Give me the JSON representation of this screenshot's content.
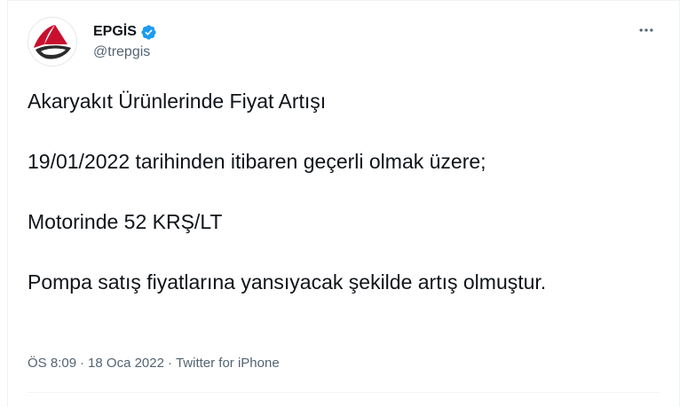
{
  "account": {
    "display_name": "EPGİS",
    "handle": "@trepgis",
    "verified_icon": "verified-badge-icon",
    "avatar_icon": "epgis-logo-icon"
  },
  "more_icon": "more-horizontal-icon",
  "tweet": {
    "lines": [
      "Akaryakıt Ürünlerinde Fiyat Artışı",
      "19/01/2022 tarihinden itibaren geçerli olmak üzere;",
      "Motorinde 52 KRŞ/LT",
      "Pompa satış fiyatlarına yansıyacak şekilde artış olmuştur."
    ]
  },
  "meta": {
    "time": "ÖS 8:09",
    "separator": "·",
    "date": "18 Oca 2022",
    "source": "Twitter for iPhone"
  },
  "colors": {
    "text_primary": "#0f1419",
    "text_secondary": "#536471",
    "verified_blue": "#1d9bf0",
    "logo_red": "#c8102e",
    "border": "#eff3f4"
  }
}
